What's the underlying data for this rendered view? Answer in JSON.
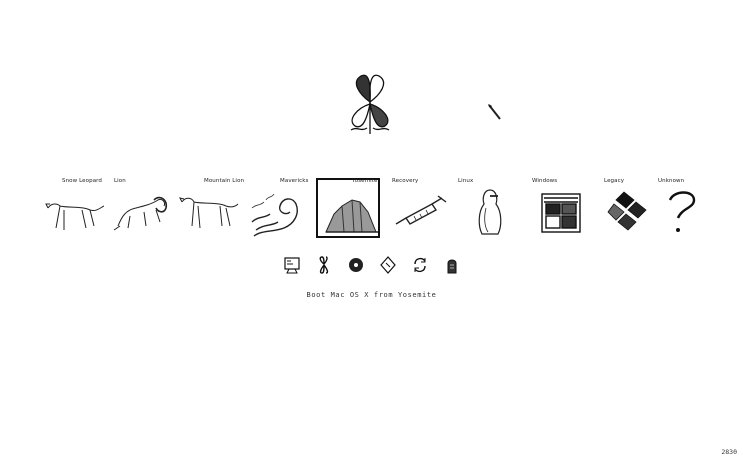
{
  "entries": [
    {
      "label": "Snow Leopard",
      "icon": "snow-leopard-icon"
    },
    {
      "label": "Lion",
      "icon": "lion-icon"
    },
    {
      "label": "Mountain Lion",
      "icon": "mountain-lion-icon"
    },
    {
      "label": "Mavericks",
      "icon": "wave-icon"
    },
    {
      "label": "Yosemite",
      "icon": "yosemite-icon",
      "selected": true
    },
    {
      "label": "Recovery",
      "icon": "syringe-icon"
    },
    {
      "label": "Linux",
      "icon": "penguin-icon"
    },
    {
      "label": "Windows",
      "icon": "windows-icon"
    },
    {
      "label": "Legacy",
      "icon": "legacy-icon"
    },
    {
      "label": "Unknown",
      "icon": "question-icon"
    }
  ],
  "tools": [
    {
      "name": "shell-tool-icon"
    },
    {
      "name": "options-tool-icon"
    },
    {
      "name": "disk-tool-icon"
    },
    {
      "name": "nvram-tool-icon"
    },
    {
      "name": "refresh-tool-icon"
    },
    {
      "name": "shutdown-tool-icon"
    }
  ],
  "status": {
    "text": "Boot Mac OS X from Yosemite"
  },
  "version": {
    "text": "2830"
  }
}
